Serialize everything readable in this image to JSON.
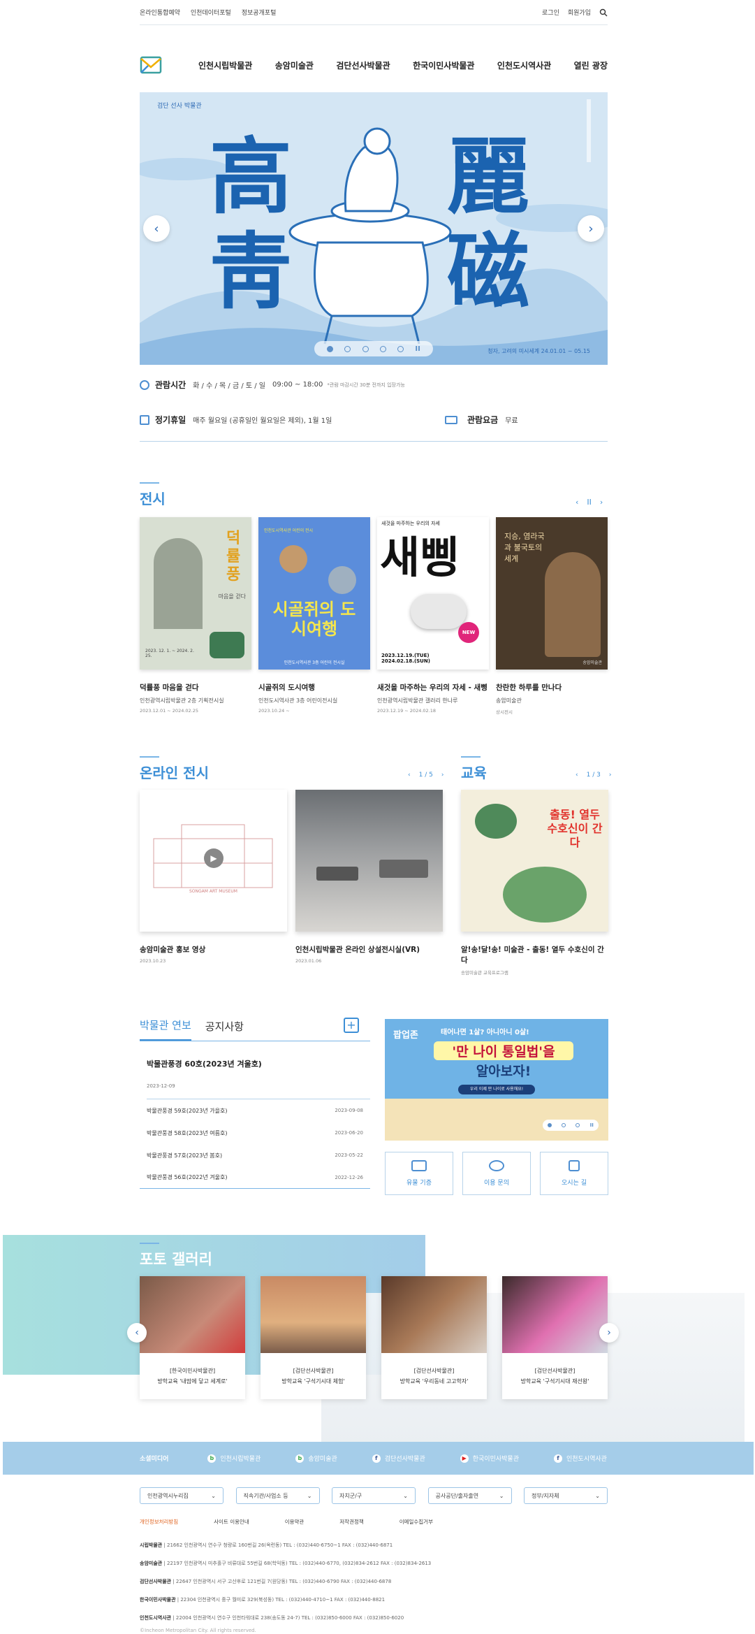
{
  "util": {
    "links": [
      "온라인통합예약",
      "인천데이터포털",
      "정보공개포털"
    ],
    "login": "로그인",
    "join": "회원가입"
  },
  "nav": {
    "items": [
      "인천시립박물관",
      "송암미술관",
      "검단선사박물관",
      "한국이민사박물관",
      "인천도시역사관",
      "열린 광장"
    ]
  },
  "hero": {
    "tag": "검단 선사 박물관",
    "chars": [
      "高",
      "麗",
      "靑",
      "磁"
    ],
    "caption": "청자, 고려의 미시세계 24.01.01 ~ 05.15"
  },
  "info": {
    "hours_label": "관람시간",
    "hours_days": "화 / 수 / 목 / 금 / 토 / 일",
    "hours_time": "09:00 ~ 18:00",
    "hours_note": "*관람 마감시간 30분 전까지 입장가능",
    "closed_label": "정기휴일",
    "closed_text": "매주 월요일 (공휴일인 월요일은 제외), 1월 1일",
    "fee_label": "관람요금",
    "fee_text": "무료"
  },
  "exhibition": {
    "title": "전시",
    "pause": "II",
    "cards": [
      {
        "title": "덕률풍 마음을 걷다",
        "sub": "인천광역시립박물관 2층 기획전시실",
        "date": "2023.12.01 ~ 2024.02.25",
        "poster_text": "덕률풍",
        "poster_sub": "마음을 걷다",
        "poster_date": "2023. 12. 1. ~ 2024. 2. 25."
      },
      {
        "title": "시골쥐의 도시여행",
        "sub": "인천도시역사관 3층 어린이전시실",
        "date": "2023.10.24 ~",
        "poster_text": "시골쥐의 도시여행",
        "poster_sub": "인천도시역사관 어린이 전시",
        "poster_date": "인천도시역사관 3층 어린이 전시실"
      },
      {
        "title": "새것을 마주하는 우리의 자세 - 새삥",
        "sub": "인천광역시립박물관 갤러리 한나루",
        "date": "2023.12.19 ~ 2024.02.18",
        "poster_text": "새삥",
        "poster_sub": "새것을 마주하는 우리의 자세",
        "poster_date": "2023.12.19.(TUE) 2024.02.18.(SUN)",
        "poster_badge": "NEW"
      },
      {
        "title": "찬란한 하루를 만나다",
        "sub": "송암미술관",
        "date": "상시전시",
        "poster_text": "지승, 염라국과 불국토의 세계",
        "poster_sub": "송암미술관"
      }
    ]
  },
  "online": {
    "title": "온라인 전시",
    "page": "1 / 5",
    "cards": [
      {
        "title": "송암미술관 홍보 영상",
        "date": "2023.10.23",
        "photo_text": "SONGAM ART MUSEUM"
      },
      {
        "title": "인천시립박물관 온라인 상설전시실(VR)",
        "date": "2023.01.06"
      }
    ]
  },
  "education": {
    "title": "교육",
    "page": "1 / 3",
    "card": {
      "title": "알!송!달!송! 미술관 - 출동! 열두 수호신이 간다",
      "sub": "송암미술관 교육프로그램",
      "poster_text": "출동! 열두 수호신이 간다"
    }
  },
  "news": {
    "tab_active": "박물관 연보",
    "tab_other": "공지사항",
    "plus": "+",
    "featured": "박물관풍경 60호(2023년 겨울호)",
    "featured_date": "2023-12-09",
    "rows": [
      {
        "t": "박물관풍경 59호(2023년 가을호)",
        "d": "2023-09-08"
      },
      {
        "t": "박물관풍경 58호(2023년 여름호)",
        "d": "2023-06-20"
      },
      {
        "t": "박물관풍경 57호(2023년 봄호)",
        "d": "2023-05-22"
      },
      {
        "t": "박물관풍경 56호(2022년 겨울호)",
        "d": "2022-12-26"
      }
    ]
  },
  "popup": {
    "label": "팝업존",
    "line1": "태어나면 1살? 아니아니 0살!",
    "line2": "'만 나이 통일법'을",
    "line3": "알아보자!",
    "pill": "우리 이제 만 나이로 사용해요!"
  },
  "quick": {
    "items": [
      "유물 기증",
      "이용 문의",
      "오시는 길"
    ]
  },
  "gallery": {
    "title": "포토 갤러리",
    "cards": [
      {
        "org": "[한국이민사박물관]",
        "desc": "방학교육 '내맘에 닿고 세계로'"
      },
      {
        "org": "[검단선사박물관]",
        "desc": "방학교육 '구석기시대 체험'"
      },
      {
        "org": "[검단선사박물관]",
        "desc": "방학교육 '우리동네 고고학자'"
      },
      {
        "org": "[검단선사박물관]",
        "desc": "방학교육 '구석기시대 재선왕'"
      }
    ]
  },
  "social": {
    "label": "소셜미디어",
    "items": [
      "인천시립박물관",
      "송암미술관",
      "검단선사박물관",
      "한국이민사박물관",
      "인천도시역사관"
    ]
  },
  "selects": [
    "인천광역시누리집",
    "직속기관/사업소 등",
    "자치군/구",
    "공사공단/출자출연",
    "정부/지자체"
  ],
  "footer_links": [
    "개인정보처리방침",
    "사이트 이용안내",
    "이용약관",
    "저작권정책",
    "이메일수집거부"
  ],
  "addresses": [
    {
      "name": "시립박물관",
      "text": "21662 인천광역시 연수구 청량로 160번길 26(옥련동) TEL : (032)440-6750~1 FAX : (032)440-6871"
    },
    {
      "name": "송암미술관",
      "text": "22197 인천광역시 미추홀구 비류대로 55번길 68(학익동) TEL : (032)440-6770, (032)834-2612 FAX : (032)834-2613"
    },
    {
      "name": "검단선사박물관",
      "text": "22647 인천광역시 서구 고산후로 121번길 7(원당동) TEL : (032)440-6790 FAX : (032)440-6878"
    },
    {
      "name": "한국이민사박물관",
      "text": "22304 인천광역시 중구 월미로 329(북성동) TEL : (032)440-4710~1 FAX : (032)440-8821"
    },
    {
      "name": "인천도시역사관",
      "text": "22004 인천광역시 연수구 인천타워대로 238(송도동 24-7) TEL : (032)850-6000 FAX : (032)850-6020"
    }
  ],
  "copyright": "©Incheon Metropolitan City. All rights reserved.",
  "colors": {
    "accent": "#3d8fd6",
    "hero_bg": "#d4e6f4",
    "social_bg": "#a5cde9"
  }
}
